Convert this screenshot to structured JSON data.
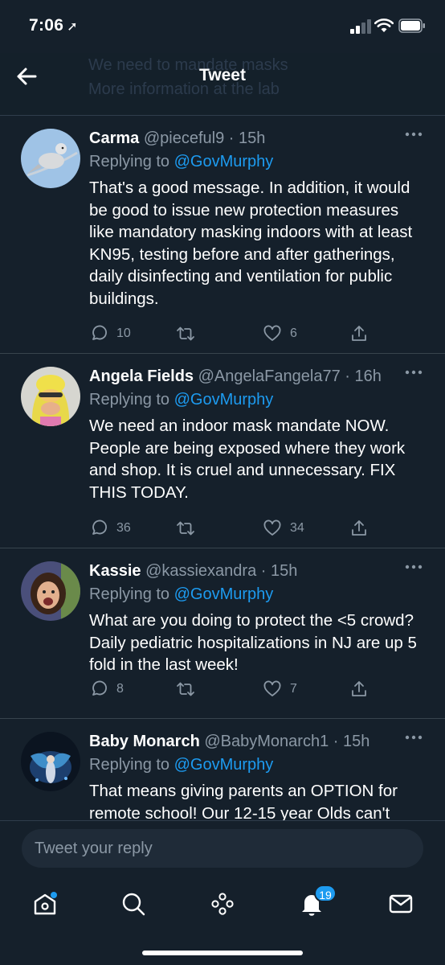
{
  "status_bar": {
    "time": "7:06"
  },
  "header": {
    "title": "Tweet"
  },
  "ghost_text": [
    "We need to mandate masks",
    "More information at the lab"
  ],
  "tweets": [
    {
      "name": "Carma",
      "handle": "@pieceful9",
      "age": "15h",
      "replying_prefix": "Replying to ",
      "replying_to": "@GovMurphy",
      "text": "That's a good message.  In addition, it would be good to issue new protection measures like mandatory masking indoors with at least KN95, testing before and after gatherings, daily disinfecting and ventilation for public buildings.",
      "replies": "10",
      "retweets": "",
      "likes": "6"
    },
    {
      "name": "Angela Fields",
      "handle": "@AngelaFangela77",
      "age": "16h",
      "replying_prefix": "Replying to ",
      "replying_to": "@GovMurphy",
      "text": "We need an indoor mask mandate NOW. People are being exposed where they work and shop. It is cruel and unnecessary. FIX THIS TODAY.",
      "replies": "36",
      "retweets": "",
      "likes": "34"
    },
    {
      "name": "Kassie",
      "handle": "@kassiexandra",
      "age": "15h",
      "replying_prefix": "Replying to ",
      "replying_to": "@GovMurphy",
      "text": "What are you doing to protect the <5 crowd? Daily pediatric hospitalizations in NJ are up 5 fold in the last week!",
      "replies": "8",
      "retweets": "",
      "likes": "7"
    },
    {
      "name": "Baby Monarch",
      "handle": "@BabyMonarch1",
      "age": "15h",
      "replying_prefix": "Replying to ",
      "replying_to": "@GovMurphy",
      "text": "That means giving parents an OPTION for remote school!  Our 12-15 year Olds can't",
      "replies": "",
      "retweets": "",
      "likes": ""
    }
  ],
  "composer": {
    "placeholder": "Tweet your reply"
  },
  "tabbar": {
    "notifications_badge": "19"
  },
  "colors": {
    "background": "#15202b",
    "accent": "#1d9bf0",
    "muted": "#8b98a5",
    "divider": "#38444d"
  }
}
